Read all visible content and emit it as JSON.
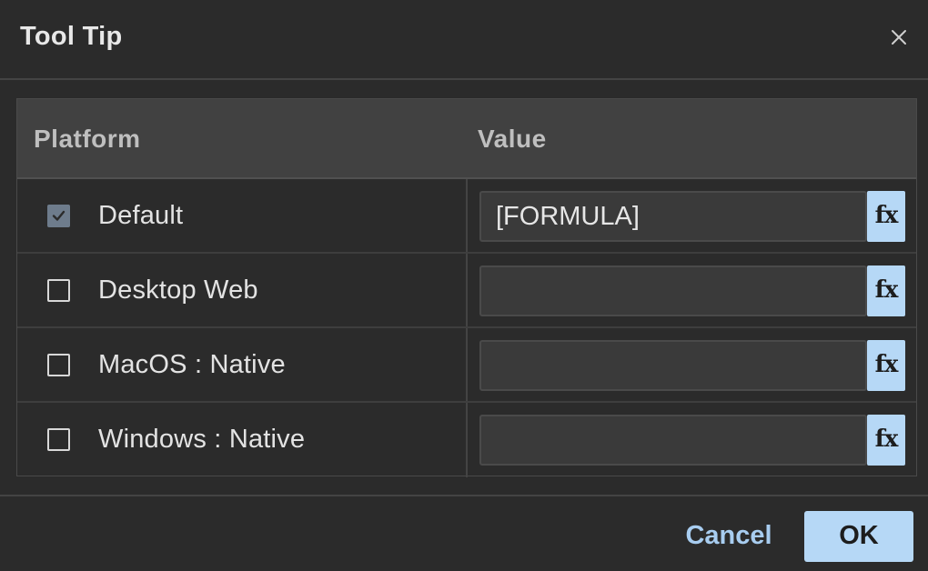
{
  "dialog": {
    "title": "Tool Tip",
    "close_icon": "close-icon"
  },
  "table": {
    "headers": {
      "platform": "Platform",
      "value": "Value"
    },
    "rows": [
      {
        "platform": "Default",
        "checked": true,
        "value": "[FORMULA]",
        "fx_label": "fx"
      },
      {
        "platform": "Desktop Web",
        "checked": false,
        "value": "",
        "fx_label": "fx"
      },
      {
        "platform": "MacOS : Native",
        "checked": false,
        "value": "",
        "fx_label": "fx"
      },
      {
        "platform": "Windows : Native",
        "checked": false,
        "value": "",
        "fx_label": "fx"
      }
    ]
  },
  "footer": {
    "cancel_label": "Cancel",
    "ok_label": "OK"
  },
  "colors": {
    "background": "#2b2b2b",
    "header_row": "#414141",
    "accent": "#b6d8f6",
    "accent_text": "#a8cdf0",
    "checked_box": "#6e7c8c"
  }
}
